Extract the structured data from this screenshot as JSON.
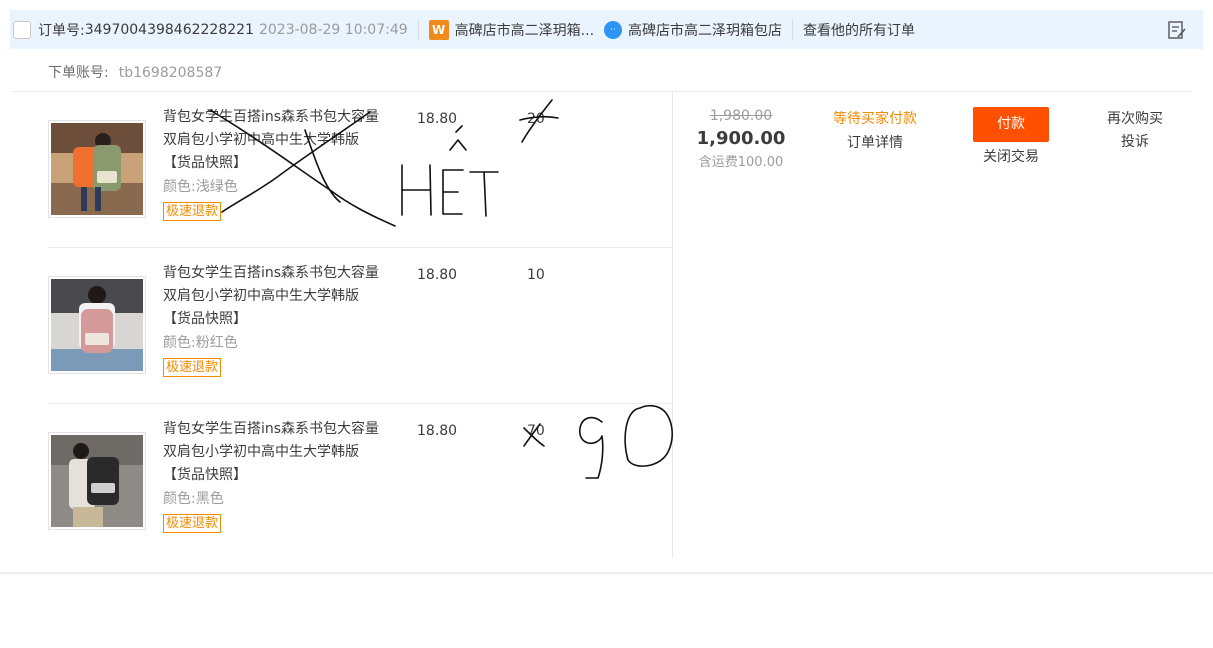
{
  "header": {
    "order_no_label": "订单号:",
    "order_no": "3497004398462228221",
    "order_time": "2023-08-29 10:07:49",
    "shop_icon_text": "W",
    "shop_name": "高碑店市高二泽玥箱...",
    "seller_icon_text": "⋅⋅",
    "seller_name": "高碑店市高二泽玥箱包店",
    "view_all_orders": "查看他的所有订单"
  },
  "account": {
    "label": "下单账号:",
    "value": "tb1698208587"
  },
  "items": [
    {
      "name": "背包女学生百搭ins森系书包大容量双肩包小学初中高中生大学韩版",
      "snapshot": "【货品快照】",
      "color": "颜色:浅绿色",
      "refund": "极速退款",
      "price": "18.80",
      "qty": "20",
      "bag_color": "#8a9a6e"
    },
    {
      "name": "背包女学生百搭ins森系书包大容量双肩包小学初中高中生大学韩版",
      "snapshot": "【货品快照】",
      "color": "颜色:粉红色",
      "refund": "极速退款",
      "price": "18.80",
      "qty": "10",
      "bag_color": "#d49a9a"
    },
    {
      "name": "背包女学生百搭ins森系书包大容量双肩包小学初中高中生大学韩版",
      "snapshot": "【货品快照】",
      "color": "颜色:黑色",
      "refund": "极速退款",
      "price": "18.80",
      "qty": "70",
      "bag_color": "#2a2a2a"
    }
  ],
  "summary": {
    "original_total": "1,980.00",
    "total": "1,900.00",
    "shipping": "含运费100.00"
  },
  "status": {
    "text": "等待买家付款",
    "detail_link": "订单详情"
  },
  "actions": {
    "pay_button": "付款",
    "close_link": "关闭交易",
    "rebuy": "再次购买",
    "complain": "投诉"
  },
  "colors": {
    "header_bg": "#eaf4fe",
    "accent_orange": "#ff5000",
    "status_orange": "#f28b00"
  }
}
